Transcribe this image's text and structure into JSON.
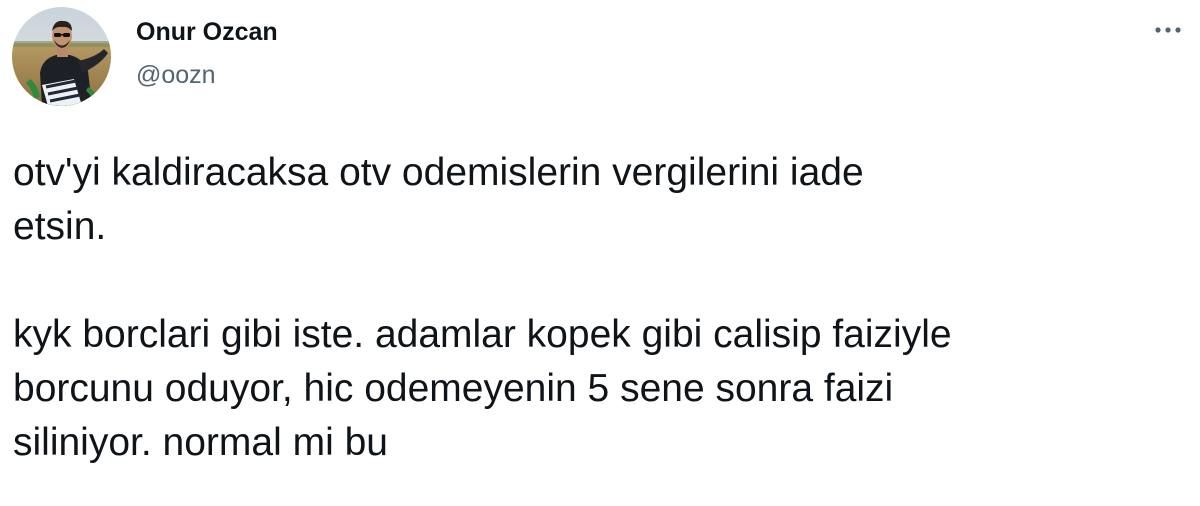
{
  "author": {
    "display_name": "Onur Ozcan",
    "handle": "@oozn"
  },
  "menu": {
    "icon": "more-horizontal-icon"
  },
  "tweet": {
    "paragraphs": [
      "otv'yi kaldiracaksa otv odemislerin vergilerini iade\netsin.",
      "kyk borclari gibi iste. adamlar kopek gibi calisip faiziyle\nborcunu oduyor, hic odemeyenin 5 sene sonra faizi\nsiliniyor. normal mi bu"
    ]
  },
  "colors": {
    "text": "#0f1419",
    "secondary": "#536471",
    "background": "#ffffff"
  }
}
